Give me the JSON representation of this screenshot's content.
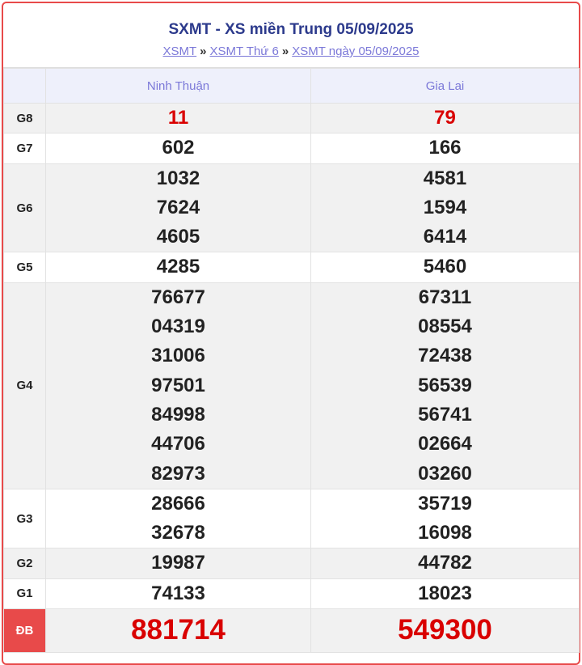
{
  "header": {
    "title": "SXMT - XS miền Trung 05/09/2025",
    "breadcrumb": [
      "XSMT",
      "XSMT Thứ 6",
      "XSMT ngày 05/09/2025"
    ],
    "separator": "»"
  },
  "table": {
    "columns": [
      "Ninh Thuận",
      "Gia Lai"
    ],
    "prizes": {
      "g8": {
        "label": "G8",
        "col1": [
          "11"
        ],
        "col2": [
          "79"
        ]
      },
      "g7": {
        "label": "G7",
        "col1": [
          "602"
        ],
        "col2": [
          "166"
        ]
      },
      "g6": {
        "label": "G6",
        "col1": [
          "1032",
          "7624",
          "4605"
        ],
        "col2": [
          "4581",
          "1594",
          "6414"
        ]
      },
      "g5": {
        "label": "G5",
        "col1": [
          "4285"
        ],
        "col2": [
          "5460"
        ]
      },
      "g4": {
        "label": "G4",
        "col1": [
          "76677",
          "04319",
          "31006",
          "97501",
          "84998",
          "44706",
          "82973"
        ],
        "col2": [
          "67311",
          "08554",
          "72438",
          "56539",
          "56741",
          "02664",
          "03260"
        ]
      },
      "g3": {
        "label": "G3",
        "col1": [
          "28666",
          "32678"
        ],
        "col2": [
          "35719",
          "16098"
        ]
      },
      "g2": {
        "label": "G2",
        "col1": [
          "19987"
        ],
        "col2": [
          "44782"
        ]
      },
      "g1": {
        "label": "G1",
        "col1": [
          "74133"
        ],
        "col2": [
          "18023"
        ]
      },
      "db": {
        "label": "ĐB",
        "col1": [
          "881714"
        ],
        "col2": [
          "549300"
        ]
      }
    }
  },
  "colors": {
    "accent_red": "#d90000",
    "frame_red": "#e84a4a",
    "title_blue": "#2c3a8c",
    "link_purple": "#7b78d8"
  }
}
